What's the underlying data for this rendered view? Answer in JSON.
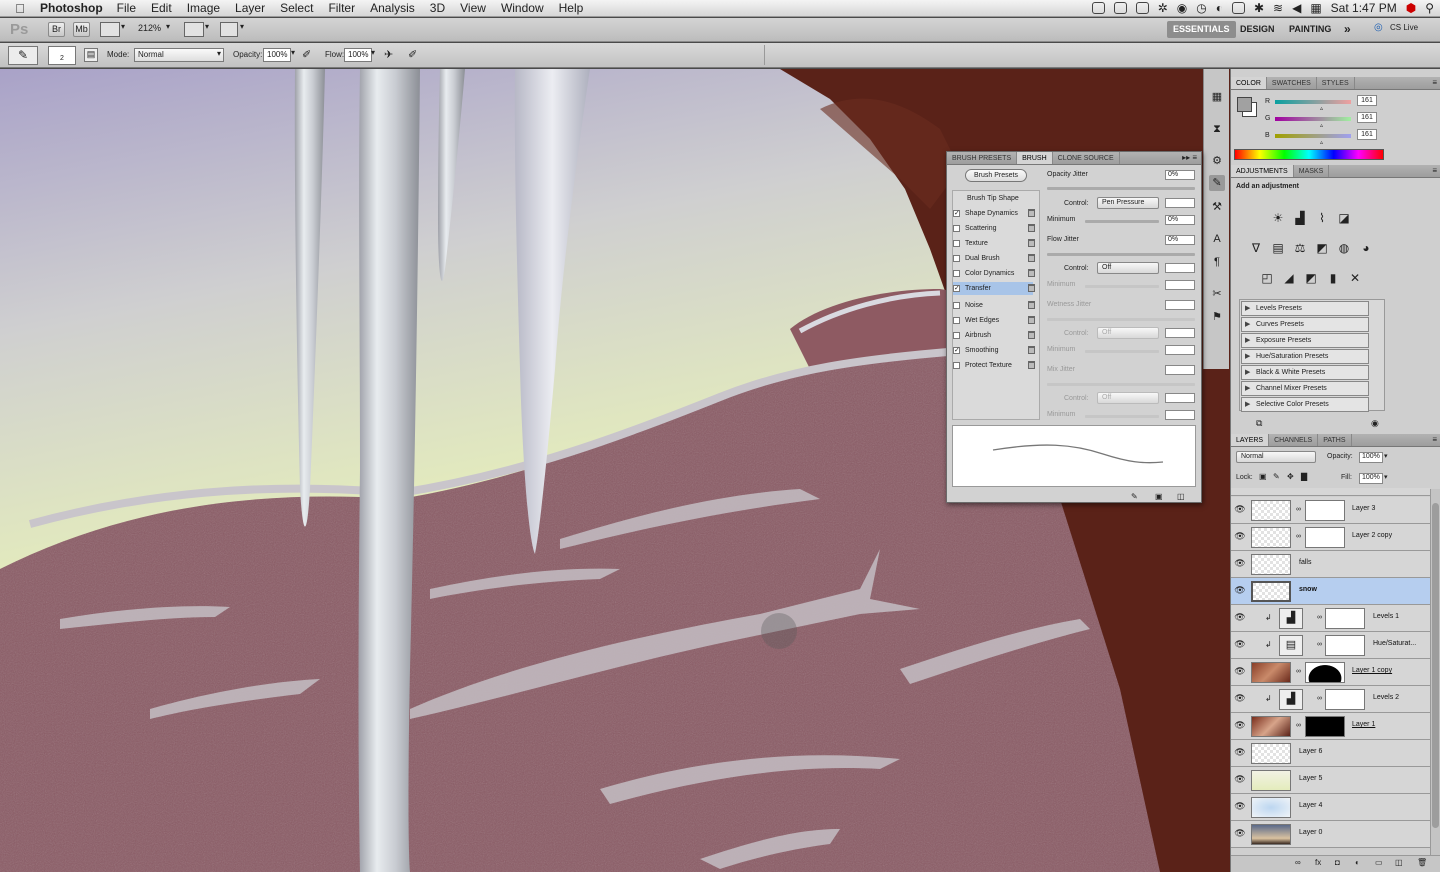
{
  "menubar": {
    "app": "Photoshop",
    "items": [
      "File",
      "Edit",
      "Image",
      "Layer",
      "Select",
      "Filter",
      "Analysis",
      "3D",
      "View",
      "Window",
      "Help"
    ],
    "clock": "Sat 1:47 PM"
  },
  "appbar": {
    "logo": "Ps",
    "br": "Br",
    "mb": "Mb",
    "zoom": "212%",
    "workspaces": [
      "ESSENTIALS",
      "DESIGN",
      "PAINTING"
    ],
    "more": "»",
    "cslive": "CS Live"
  },
  "options": {
    "brush_size": "2",
    "mode_label": "Mode:",
    "mode_value": "Normal",
    "opacity_label": "Opacity:",
    "opacity_value": "100%",
    "flow_label": "Flow:",
    "flow_value": "100%"
  },
  "brush_panel": {
    "tabs": [
      "BRUSH PRESETS",
      "BRUSH",
      "CLONE SOURCE"
    ],
    "presets_button": "Brush Presets",
    "tip_shape": "Brush Tip Shape",
    "options": [
      {
        "label": "Shape Dynamics",
        "checked": true
      },
      {
        "label": "Scattering",
        "checked": false
      },
      {
        "label": "Texture",
        "checked": false
      },
      {
        "label": "Dual Brush",
        "checked": false
      },
      {
        "label": "Color Dynamics",
        "checked": false
      },
      {
        "label": "Transfer",
        "checked": true
      },
      {
        "label": "Noise",
        "checked": false
      },
      {
        "label": "Wet Edges",
        "checked": false
      },
      {
        "label": "Airbrush",
        "checked": false
      },
      {
        "label": "Smoothing",
        "checked": true
      },
      {
        "label": "Protect Texture",
        "checked": false
      }
    ],
    "opacity_jitter": "Opacity Jitter",
    "opacity_jitter_val": "0%",
    "control": "Control:",
    "control1": "Pen Pressure",
    "minimum": "Minimum",
    "minimum1_val": "0%",
    "flow_jitter": "Flow Jitter",
    "flow_jitter_val": "0%",
    "control2": "Off",
    "wetness_jitter": "Wetness Jitter",
    "control3": "Off",
    "mix_jitter": "Mix Jitter",
    "control4": "Off"
  },
  "color_panel": {
    "tabs": [
      "COLOR",
      "SWATCHES",
      "STYLES"
    ],
    "r_label": "R",
    "g_label": "G",
    "b_label": "B",
    "r": "161",
    "g": "161",
    "b": "161"
  },
  "adjustments_panel": {
    "tabs": [
      "ADJUSTMENTS",
      "MASKS"
    ],
    "title": "Add an adjustment",
    "presets": [
      "Levels Presets",
      "Curves Presets",
      "Exposure Presets",
      "Hue/Saturation Presets",
      "Black & White Presets",
      "Channel Mixer Presets",
      "Selective Color Presets"
    ]
  },
  "layers_panel": {
    "tabs": [
      "LAYERS",
      "CHANNELS",
      "PATHS"
    ],
    "blend": "Normal",
    "opacity_label": "Opacity:",
    "opacity": "100%",
    "lock_label": "Lock:",
    "fill_label": "Fill:",
    "fill": "100%",
    "layers": [
      {
        "name": "Layer 3",
        "kind": "mask",
        "selected": false
      },
      {
        "name": "Layer 2 copy",
        "kind": "mask",
        "selected": false
      },
      {
        "name": "falls",
        "kind": "plain",
        "selected": false
      },
      {
        "name": "snow",
        "kind": "plain",
        "selected": true
      },
      {
        "name": "Levels 1",
        "kind": "adjust",
        "selected": false
      },
      {
        "name": "Hue/Saturat...",
        "kind": "adjust",
        "selected": false
      },
      {
        "name": "Layer 1 copy",
        "kind": "photo-mask",
        "selected": false
      },
      {
        "name": "Levels 2",
        "kind": "adjust",
        "selected": false
      },
      {
        "name": "Layer 1",
        "kind": "photo-mask",
        "selected": false
      },
      {
        "name": "Layer 6",
        "kind": "plain",
        "selected": false
      },
      {
        "name": "Layer 5",
        "kind": "plain",
        "selected": false
      },
      {
        "name": "Layer 4",
        "kind": "plain",
        "selected": false
      },
      {
        "name": "Layer 0",
        "kind": "photo",
        "selected": false
      }
    ]
  },
  "colors": {
    "selection": "#b6ceef",
    "rock": "#8a5a64",
    "sky_top": "#a9a3c9",
    "sky_bottom": "#e4ecbc",
    "arch": "#5a2218"
  }
}
